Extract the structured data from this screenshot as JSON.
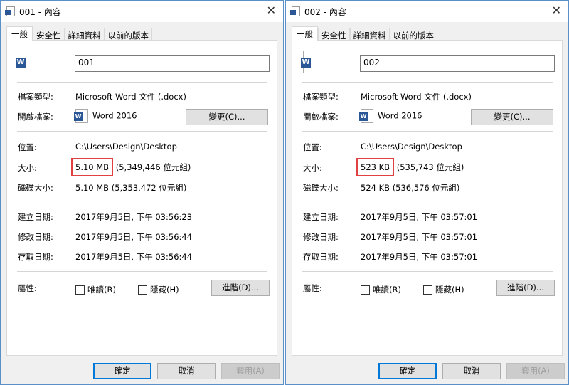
{
  "windows": [
    {
      "title": "001 - 內容",
      "tabs": [
        "一般",
        "安全性",
        "詳細資料",
        "以前的版本"
      ],
      "filename": "001",
      "labels": {
        "type": "檔案類型:",
        "opens": "開啟檔案:",
        "location": "位置:",
        "size": "大小:",
        "disk": "磁碟大小:",
        "created": "建立日期:",
        "modified": "修改日期:",
        "accessed": "存取日期:",
        "attrs": "屬性:"
      },
      "type": "Microsoft Word 文件 (.docx)",
      "opens": "Word 2016",
      "change": "變更(C)...",
      "location": "C:\\Users\\Design\\Desktop",
      "size_short": "5.10 MB",
      "size_rest": " (5,349,446 位元組)",
      "disk": "5.10 MB (5,353,472 位元組)",
      "created": "2017年9月5日, 下午 03:56:23",
      "modified": "2017年9月5日, 下午 03:56:44",
      "accessed": "2017年9月5日, 下午 03:56:44",
      "readonly": "唯讀(R)",
      "hidden": "隱藏(H)",
      "advanced": "進階(D)...",
      "ok": "確定",
      "cancel": "取消",
      "apply": "套用(A)"
    },
    {
      "title": "002 - 內容",
      "tabs": [
        "一般",
        "安全性",
        "詳細資料",
        "以前的版本"
      ],
      "filename": "002",
      "labels": {
        "type": "檔案類型:",
        "opens": "開啟檔案:",
        "location": "位置:",
        "size": "大小:",
        "disk": "磁碟大小:",
        "created": "建立日期:",
        "modified": "修改日期:",
        "accessed": "存取日期:",
        "attrs": "屬性:"
      },
      "type": "Microsoft Word 文件 (.docx)",
      "opens": "Word 2016",
      "change": "變更(C)...",
      "location": "C:\\Users\\Design\\Desktop",
      "size_short": "523 KB",
      "size_rest": " (535,743 位元組)",
      "disk": "524 KB (536,576 位元組)",
      "created": "2017年9月5日, 下午 03:57:01",
      "modified": "2017年9月5日, 下午 03:57:01",
      "accessed": "2017年9月5日, 下午 03:57:01",
      "readonly": "唯讀(R)",
      "hidden": "隱藏(H)",
      "advanced": "進階(D)...",
      "ok": "確定",
      "cancel": "取消",
      "apply": "套用(A)"
    }
  ]
}
